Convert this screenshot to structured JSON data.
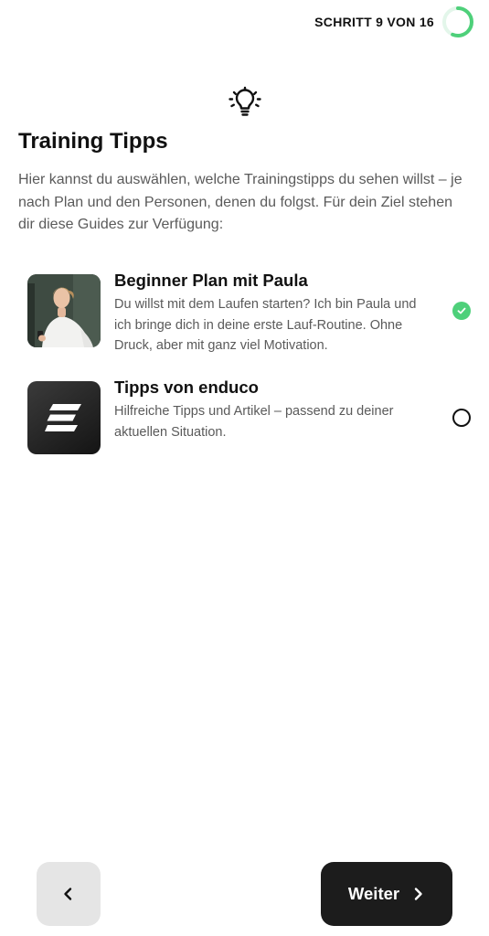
{
  "header": {
    "step_label": "SCHRITT 9 VON 16",
    "progress": {
      "current": 9,
      "total": 16
    },
    "accent_color": "#4ed07a"
  },
  "main": {
    "icon": "lightbulb-icon",
    "title": "Training Tipps",
    "intro": "Hier kannst du auswählen, welche Trainingstipps du sehen willst – je nach Plan und den Personen, denen du folgst. Für dein Ziel stehen dir diese Guides zur Verfügung:",
    "options": [
      {
        "title": "Beginner Plan mit Paula",
        "description": "Du willst mit dem Laufen starten? Ich bin Paula und ich bringe dich in deine erste Lauf-Routine. Ohne Druck, aber mit ganz viel Motivation.",
        "selected": true,
        "image": "paula-photo"
      },
      {
        "title": "Tipps von enduco",
        "description": "Hilfreiche Tipps und Artikel – passend zu deiner aktuellen Situation.",
        "selected": false,
        "image": "enduco-logo"
      }
    ]
  },
  "footer": {
    "back_icon": "chevron-left-icon",
    "next_label": "Weiter",
    "next_icon": "chevron-right-icon"
  }
}
